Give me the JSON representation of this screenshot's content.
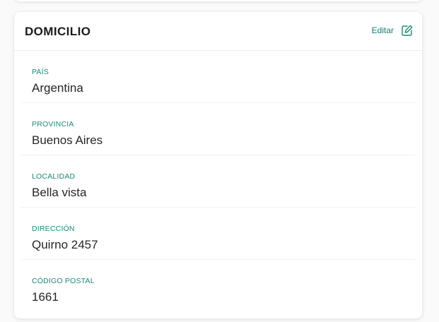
{
  "colors": {
    "accent": "#1a8a78",
    "text": "#262626",
    "title": "#1b1b1b",
    "background": "#fafafa",
    "card": "#ffffff"
  },
  "card": {
    "title": "DOMICILIO",
    "edit_label": "Editar",
    "edit_icon": "edit-icon"
  },
  "fields": [
    {
      "label": "PAÍS",
      "value": "Argentina"
    },
    {
      "label": "PROVINCIA",
      "value": "Buenos Aires"
    },
    {
      "label": "LOCALIDAD",
      "value": "Bella vista"
    },
    {
      "label": "DIRECCIÓN",
      "value": "Quirno 2457"
    },
    {
      "label": "CÓDIGO POSTAL",
      "value": "1661"
    }
  ]
}
